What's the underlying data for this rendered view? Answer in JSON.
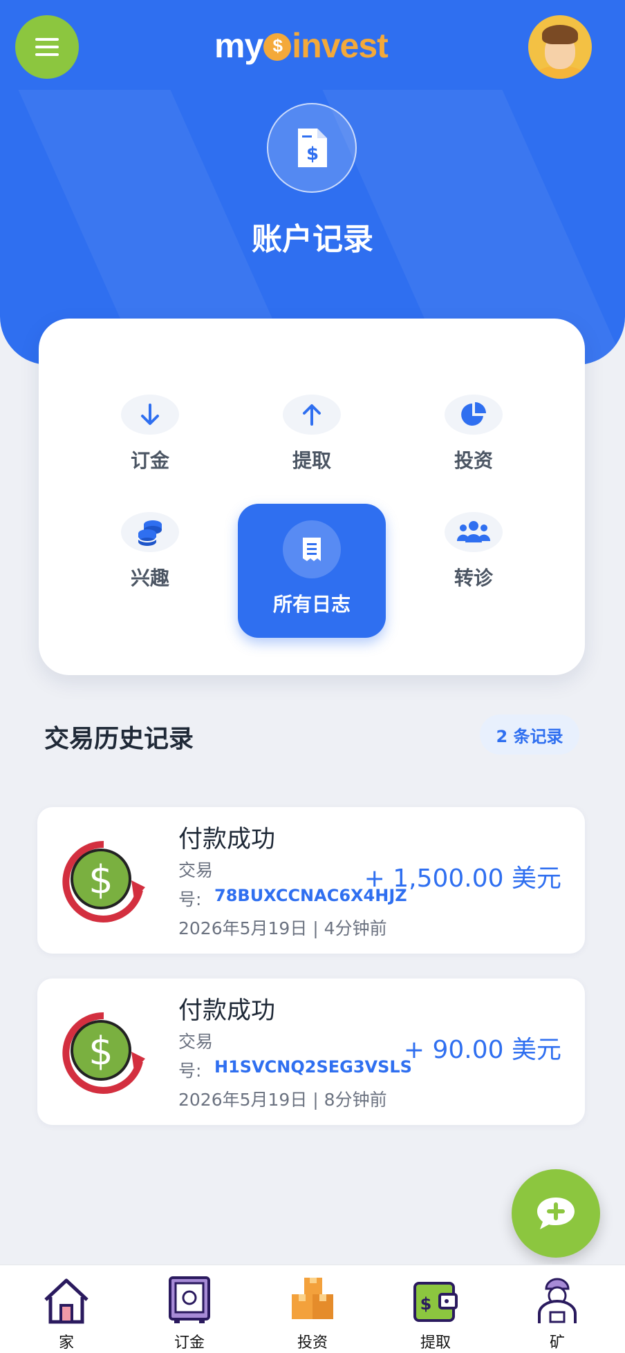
{
  "header": {
    "logo_left": "my",
    "logo_right": "invest",
    "title": "账户记录"
  },
  "nav": {
    "items": [
      {
        "label": "订金",
        "icon": "arrow-down-icon"
      },
      {
        "label": "提取",
        "icon": "arrow-up-icon"
      },
      {
        "label": "投资",
        "icon": "pie-chart-icon"
      },
      {
        "label": "兴趣",
        "icon": "coins-stack-icon"
      },
      {
        "label": "所有日志",
        "icon": "receipt-icon",
        "active": true
      },
      {
        "label": "转诊",
        "icon": "users-icon"
      }
    ]
  },
  "history": {
    "title": "交易历史记录",
    "count": "2 条记录",
    "transactions": [
      {
        "status": "付款成功",
        "label_top": "交易",
        "label_bottom": "号:",
        "id": "78BUXCCNAC6X4HJZ",
        "date": "2026年5月19日 | 4分钟前",
        "amount": "+ 1,500.00 美元"
      },
      {
        "status": "付款成功",
        "label_top": "交易",
        "label_bottom": "号:",
        "id": "H1SVCNQ2SEG3VSLS",
        "date": "2026年5月19日 | 8分钟前",
        "amount": "+ 90.00 美元"
      }
    ]
  },
  "tabbar": {
    "items": [
      {
        "label": "家",
        "icon": "home-icon"
      },
      {
        "label": "订金",
        "icon": "safe-icon"
      },
      {
        "label": "投资",
        "icon": "boxes-icon"
      },
      {
        "label": "提取",
        "icon": "wallet-icon"
      },
      {
        "label": "矿",
        "icon": "miner-icon"
      }
    ]
  },
  "colors": {
    "primary": "#2f6ff0",
    "accent_green": "#8cc63f",
    "logo_orange": "#f4a93a",
    "background": "#eef0f5"
  }
}
